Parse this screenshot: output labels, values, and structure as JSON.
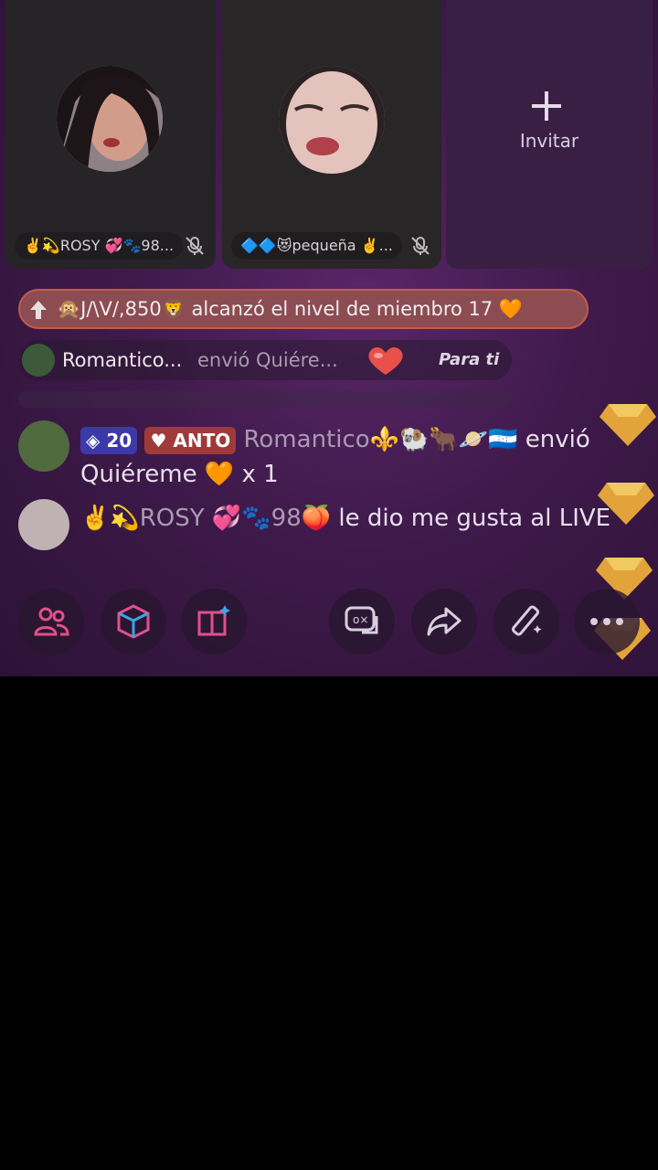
{
  "guests": [
    {
      "name": "✌️💫ROSY 💞🐾98...",
      "muted": true
    },
    {
      "name": "🔷🔷😻pequeña ✌️...",
      "muted": true
    }
  ],
  "invite": {
    "label": "Invitar"
  },
  "banner": {
    "text": "🙊J/\\V/,850🦁 alcanzó el nivel de miembro 17 🧡"
  },
  "gift_bar": {
    "sender": "Romantico...",
    "action": "envió",
    "gift": "Quiére...",
    "target": "Para ti"
  },
  "messages": [
    {
      "level": "20",
      "fan_badge": "ANTO",
      "user": "Romantico⚜️🐏🐂🪐🇭🇳",
      "text_pre": "envió",
      "text_post": "Quiéreme 🧡 x 1"
    },
    {
      "user": "✌️💫ROSY 💞🐾98🍑",
      "text": "le dio me gusta al LIVE"
    }
  ],
  "toolbar": {
    "buttons": [
      "people-icon",
      "cube-icon",
      "book-sparkle-icon",
      "comment-icon",
      "share-icon",
      "wand-icon",
      "more-icon"
    ]
  },
  "colors": {
    "background": "#000000",
    "stream": "#3f1a4b",
    "banner": "#8c4c52"
  }
}
